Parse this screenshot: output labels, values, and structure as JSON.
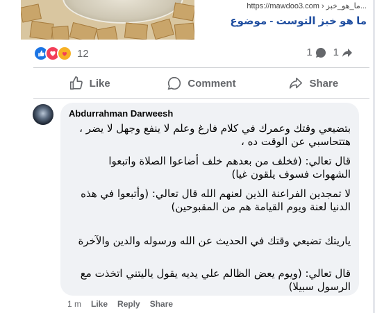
{
  "link_preview": {
    "url": "https://mawdoo3.com › ما_هو_خبز...",
    "title": "ما هو خبز التوست - موضوع"
  },
  "reactions": {
    "count": "12",
    "types": [
      "like-icon",
      "love-icon",
      "care-icon"
    ],
    "comments_count": "1",
    "shares_count": "1"
  },
  "actions": {
    "like": "Like",
    "comment": "Comment",
    "share": "Share"
  },
  "comment": {
    "author": "Abdurrahman Darweesh",
    "paragraphs": [
      "بتضيعي وقتك وعمرك في كلام فارغ وعلم لا ينفع وجهل لا يضر ، هتتحاسبي عن الوقت ده ،",
      "قال تعالي: (فخلف من بعدهم خلف أضاعوا الصلاة واتبعوا الشهوات فسوف يلقون غيا)",
      "لا تمجدين الفراعنة الذين لعنهم الله قال تعالي: (وأتبعوا في هذه الدنيا لعنة ويوم القيامة هم من المقبوحين)",
      "ياريتك تضيعي وقتك في الحديث عن الله ورسوله والدين والآخرة",
      "قال تعالي: (ويوم يعض الظالم علي يديه يقول ياليتني اتخذت مع الرسول سبيلا)"
    ],
    "time": "1 m",
    "like": "Like",
    "reply": "Reply",
    "share": "Share"
  },
  "colors": {
    "like_blue": "#1b74e4",
    "love_red": "#f33e58",
    "care_yellow": "#f7b125",
    "link_title": "#1f4ea0",
    "bubble_bg": "#f0f2f5",
    "secondary_text": "#65676b"
  }
}
